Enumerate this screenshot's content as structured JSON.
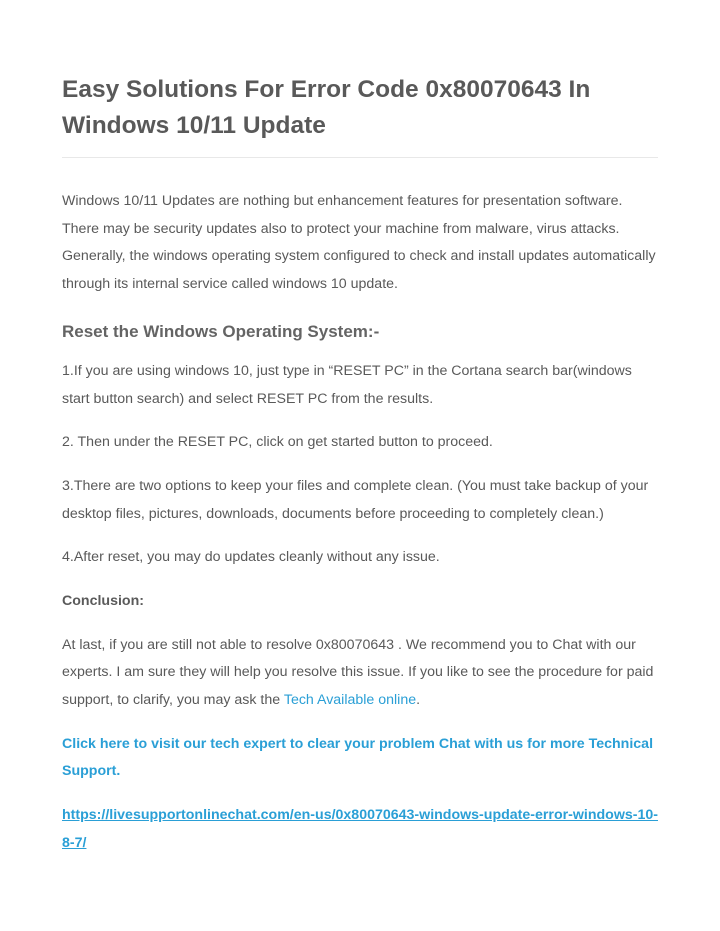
{
  "title": "Easy Solutions For Error Code 0x80070643 In Windows 10/11 Update",
  "intro": "Windows 10/11 Updates are nothing but enhancement features for presentation software. There may be security updates also to protect your machine from malware, virus attacks. Generally, the windows operating system configured to check and install updates automatically through its internal service called windows 10 update.",
  "section_heading": "Reset the Windows Operating System:-",
  "steps": {
    "s1": "1.If you are using windows 10, just type in “RESET PC” in the Cortana search bar(windows start button search) and select RESET PC from the results.",
    "s2": "2. Then under the RESET PC, click on get started button to proceed.",
    "s3": "3.There are two options to keep your files and complete clean. (You must take backup of your desktop files, pictures, downloads, documents before proceeding to completely clean.)",
    "s4": "4.After reset, you may do updates cleanly without any issue."
  },
  "conclusion_label": "Conclusion:",
  "conclusion_text_before": "At last, if you are still not able to resolve 0x80070643 . We recommend you to Chat with our experts. I am sure they will help you resolve this issue. If you like to see the procedure for paid support, to clarify, you may ask the ",
  "conclusion_link": "Tech Available online",
  "conclusion_text_after": ".",
  "cta": "Click here to visit our tech expert to clear your problem Chat with us for more Technical Support.",
  "url": "https://livesupportonlinechat.com/en-us/0x80070643-windows-update-error-windows-10-8-7/"
}
